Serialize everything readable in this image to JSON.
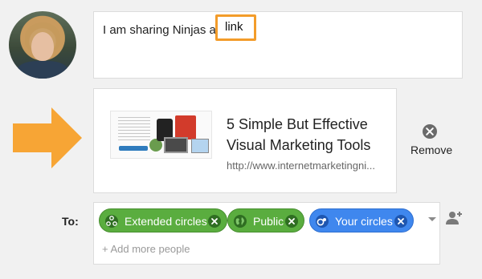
{
  "compose": {
    "text": "I am sharing Ninjas as",
    "link_chip_label": "link"
  },
  "preview": {
    "title": "5 Simple But Effective Visual Marketing Tools",
    "url": "http://www.internetmarketingni...",
    "remove_label": "Remove"
  },
  "share": {
    "to_label": "To:",
    "chips": [
      {
        "label": "Extended circles",
        "icon": "extended-circles-icon",
        "color": "#5aad3f"
      },
      {
        "label": "Public",
        "icon": "globe-icon",
        "color": "#5aad3f"
      },
      {
        "label": "Your circles",
        "icon": "circles-icon",
        "color": "#3f87ee"
      }
    ],
    "add_more_placeholder": "+ Add more people"
  },
  "colors": {
    "highlight": "#f39c2a",
    "arrow": "#f7a535"
  }
}
